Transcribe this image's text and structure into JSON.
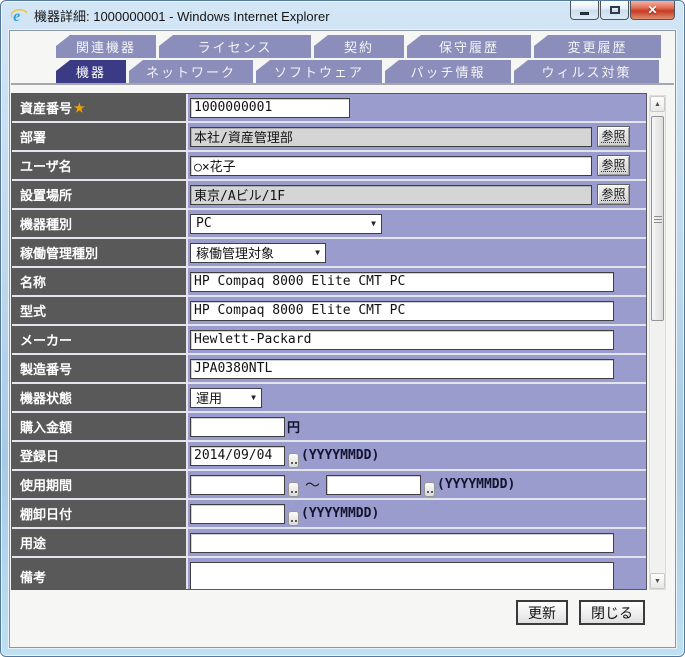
{
  "window": {
    "title": "機器詳細: 1000000001 - Windows Internet Explorer"
  },
  "icons": {
    "ie_logo": "e",
    "close": "✕",
    "dropdown_arrow": "▼",
    "scroll_up": "▲",
    "scroll_down": "▼"
  },
  "tabs": {
    "row1": [
      {
        "label": "関連機器"
      },
      {
        "label": "ライセンス"
      },
      {
        "label": "契約"
      },
      {
        "label": "保守履歴"
      },
      {
        "label": "変更履歴"
      }
    ],
    "row2": [
      {
        "label": "機器",
        "active": true
      },
      {
        "label": "ネットワーク"
      },
      {
        "label": "ソフトウェア"
      },
      {
        "label": "パッチ情報"
      },
      {
        "label": "ウィルス対策"
      }
    ]
  },
  "form": {
    "fields": {
      "asset_no": {
        "label": "資産番号",
        "required_mark": "★",
        "value": "1000000001"
      },
      "department": {
        "label": "部署",
        "value": "本社/資産管理部",
        "readonly": true,
        "ref_label": "参照"
      },
      "user_name": {
        "label": "ユーザ名",
        "value": "○×花子",
        "ref_label": "参照"
      },
      "location": {
        "label": "設置場所",
        "value": "東京/Aビル/1F",
        "readonly": true,
        "ref_label": "参照"
      },
      "device_type": {
        "label": "機器種別",
        "value": "PC"
      },
      "operation_mgmt": {
        "label": "稼働管理種別",
        "value": "稼働管理対象"
      },
      "name": {
        "label": "名称",
        "value": "HP Compaq 8000 Elite CMT PC"
      },
      "model": {
        "label": "型式",
        "value": "HP Compaq 8000 Elite CMT PC"
      },
      "maker": {
        "label": "メーカー",
        "value": "Hewlett-Packard"
      },
      "serial_no": {
        "label": "製造番号",
        "value": "JPA0380NTL"
      },
      "device_status": {
        "label": "機器状態",
        "value": "運用"
      },
      "purchase_amount": {
        "label": "購入金額",
        "value": "",
        "unit": "円"
      },
      "registration_date": {
        "label": "登録日",
        "value": "2014/09/04",
        "format_hint": "(YYYYMMDD)"
      },
      "usage_period": {
        "label": "使用期間",
        "from": "",
        "to": "",
        "separator": "～",
        "format_hint": "(YYYYMMDD)"
      },
      "inventory_date": {
        "label": "棚卸日付",
        "value": "",
        "format_hint": "(YYYYMMDD)"
      },
      "usage": {
        "label": "用途",
        "value": ""
      },
      "remarks": {
        "label": "備考",
        "value": ""
      }
    }
  },
  "footer": {
    "update_label": "更新",
    "close_label": "閉じる"
  },
  "colors": {
    "row_bg": "#9b9cce",
    "label_bg": "#595959",
    "tab_active": "#3a3a85",
    "tab_inactive": "#8b8eba",
    "required_star": "#f0a000",
    "close_button": "#c73a22"
  }
}
